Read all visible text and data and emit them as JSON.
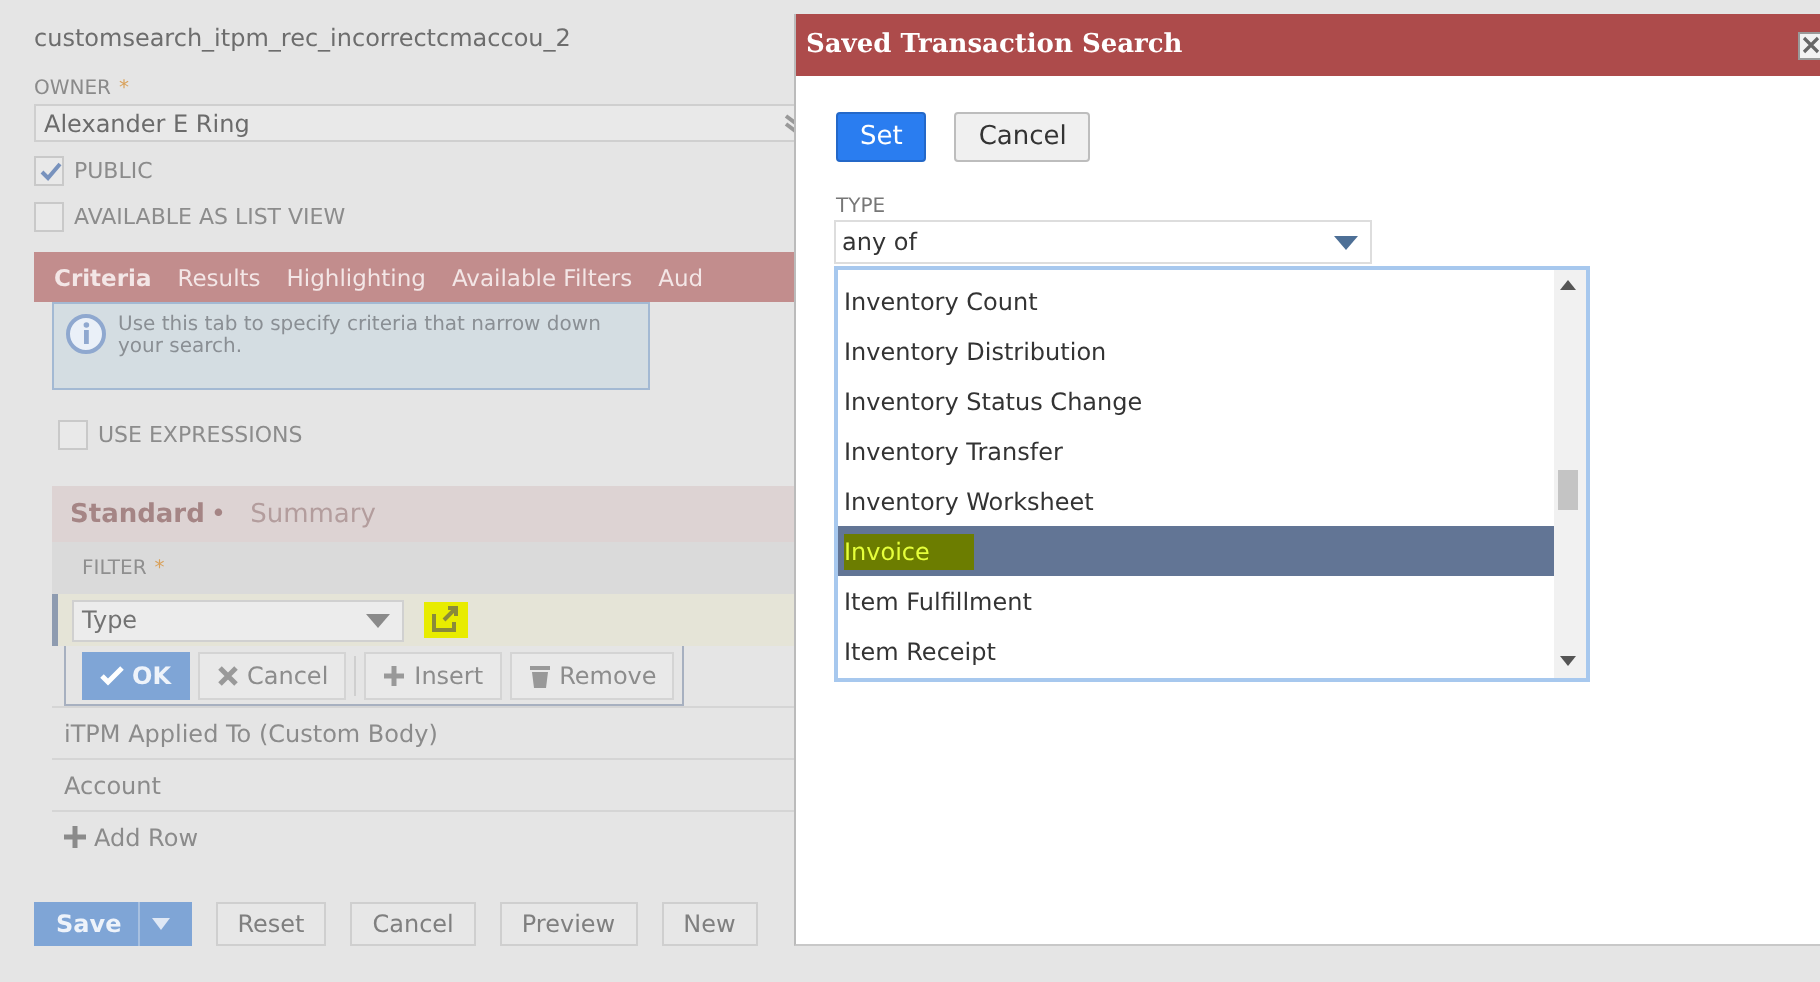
{
  "page": {
    "search_id": "customsearch_itpm_rec_incorrectcmaccou_2",
    "owner": {
      "label": "OWNER",
      "required_mark": "*",
      "value": "Alexander E Ring"
    },
    "checkboxes": [
      {
        "label": "PUBLIC",
        "checked": true
      },
      {
        "label": "AVAILABLE AS LIST VIEW",
        "checked": false
      }
    ],
    "tabs": [
      {
        "label": "Criteria",
        "selected": true
      },
      {
        "label": "Results",
        "selected": false
      },
      {
        "label": "Highlighting",
        "selected": false
      },
      {
        "label": "Available Filters",
        "selected": false
      },
      {
        "label": "Aud",
        "selected": false
      }
    ],
    "info": "Use this tab to specify criteria that narrow down your search.",
    "use_expressions": {
      "label": "USE EXPRESSIONS",
      "checked": false
    },
    "subtabs": [
      {
        "label": "Standard",
        "marker": "•",
        "selected": true
      },
      {
        "label": "Summary",
        "selected": false
      }
    ],
    "filter_header": {
      "label": "FILTER",
      "required_mark": "*"
    },
    "edit_row": {
      "value": "Type"
    },
    "row_buttons": [
      {
        "kind": "ok",
        "label": "OK"
      },
      {
        "kind": "cancel",
        "label": "Cancel"
      },
      {
        "kind": "insert",
        "label": "Insert"
      },
      {
        "kind": "remove",
        "label": "Remove"
      }
    ],
    "rows": [
      "iTPM Applied To (Custom Body)",
      "Account"
    ],
    "add_row": "Add Row",
    "footer_buttons": [
      {
        "kind": "primary",
        "label": "Save"
      },
      {
        "kind": "plain",
        "label": "Reset"
      },
      {
        "kind": "plain",
        "label": "Cancel"
      },
      {
        "kind": "plain",
        "label": "Preview"
      },
      {
        "kind": "plain",
        "label": "New"
      }
    ]
  },
  "dialog": {
    "title": "Saved Transaction Search",
    "buttons": [
      {
        "kind": "primary",
        "label": "Set"
      },
      {
        "kind": "plain",
        "label": "Cancel"
      }
    ],
    "type_label": "TYPE",
    "operator": "any of",
    "options": [
      {
        "label": "Inventory Count",
        "selected": false
      },
      {
        "label": "Inventory Distribution",
        "selected": false
      },
      {
        "label": "Inventory Status Change",
        "selected": false
      },
      {
        "label": "Inventory Transfer",
        "selected": false
      },
      {
        "label": "Inventory Worksheet",
        "selected": false
      },
      {
        "label": "Invoice",
        "selected": true
      },
      {
        "label": "Item Fulfillment",
        "selected": false
      },
      {
        "label": "Item Receipt",
        "selected": false
      }
    ]
  }
}
